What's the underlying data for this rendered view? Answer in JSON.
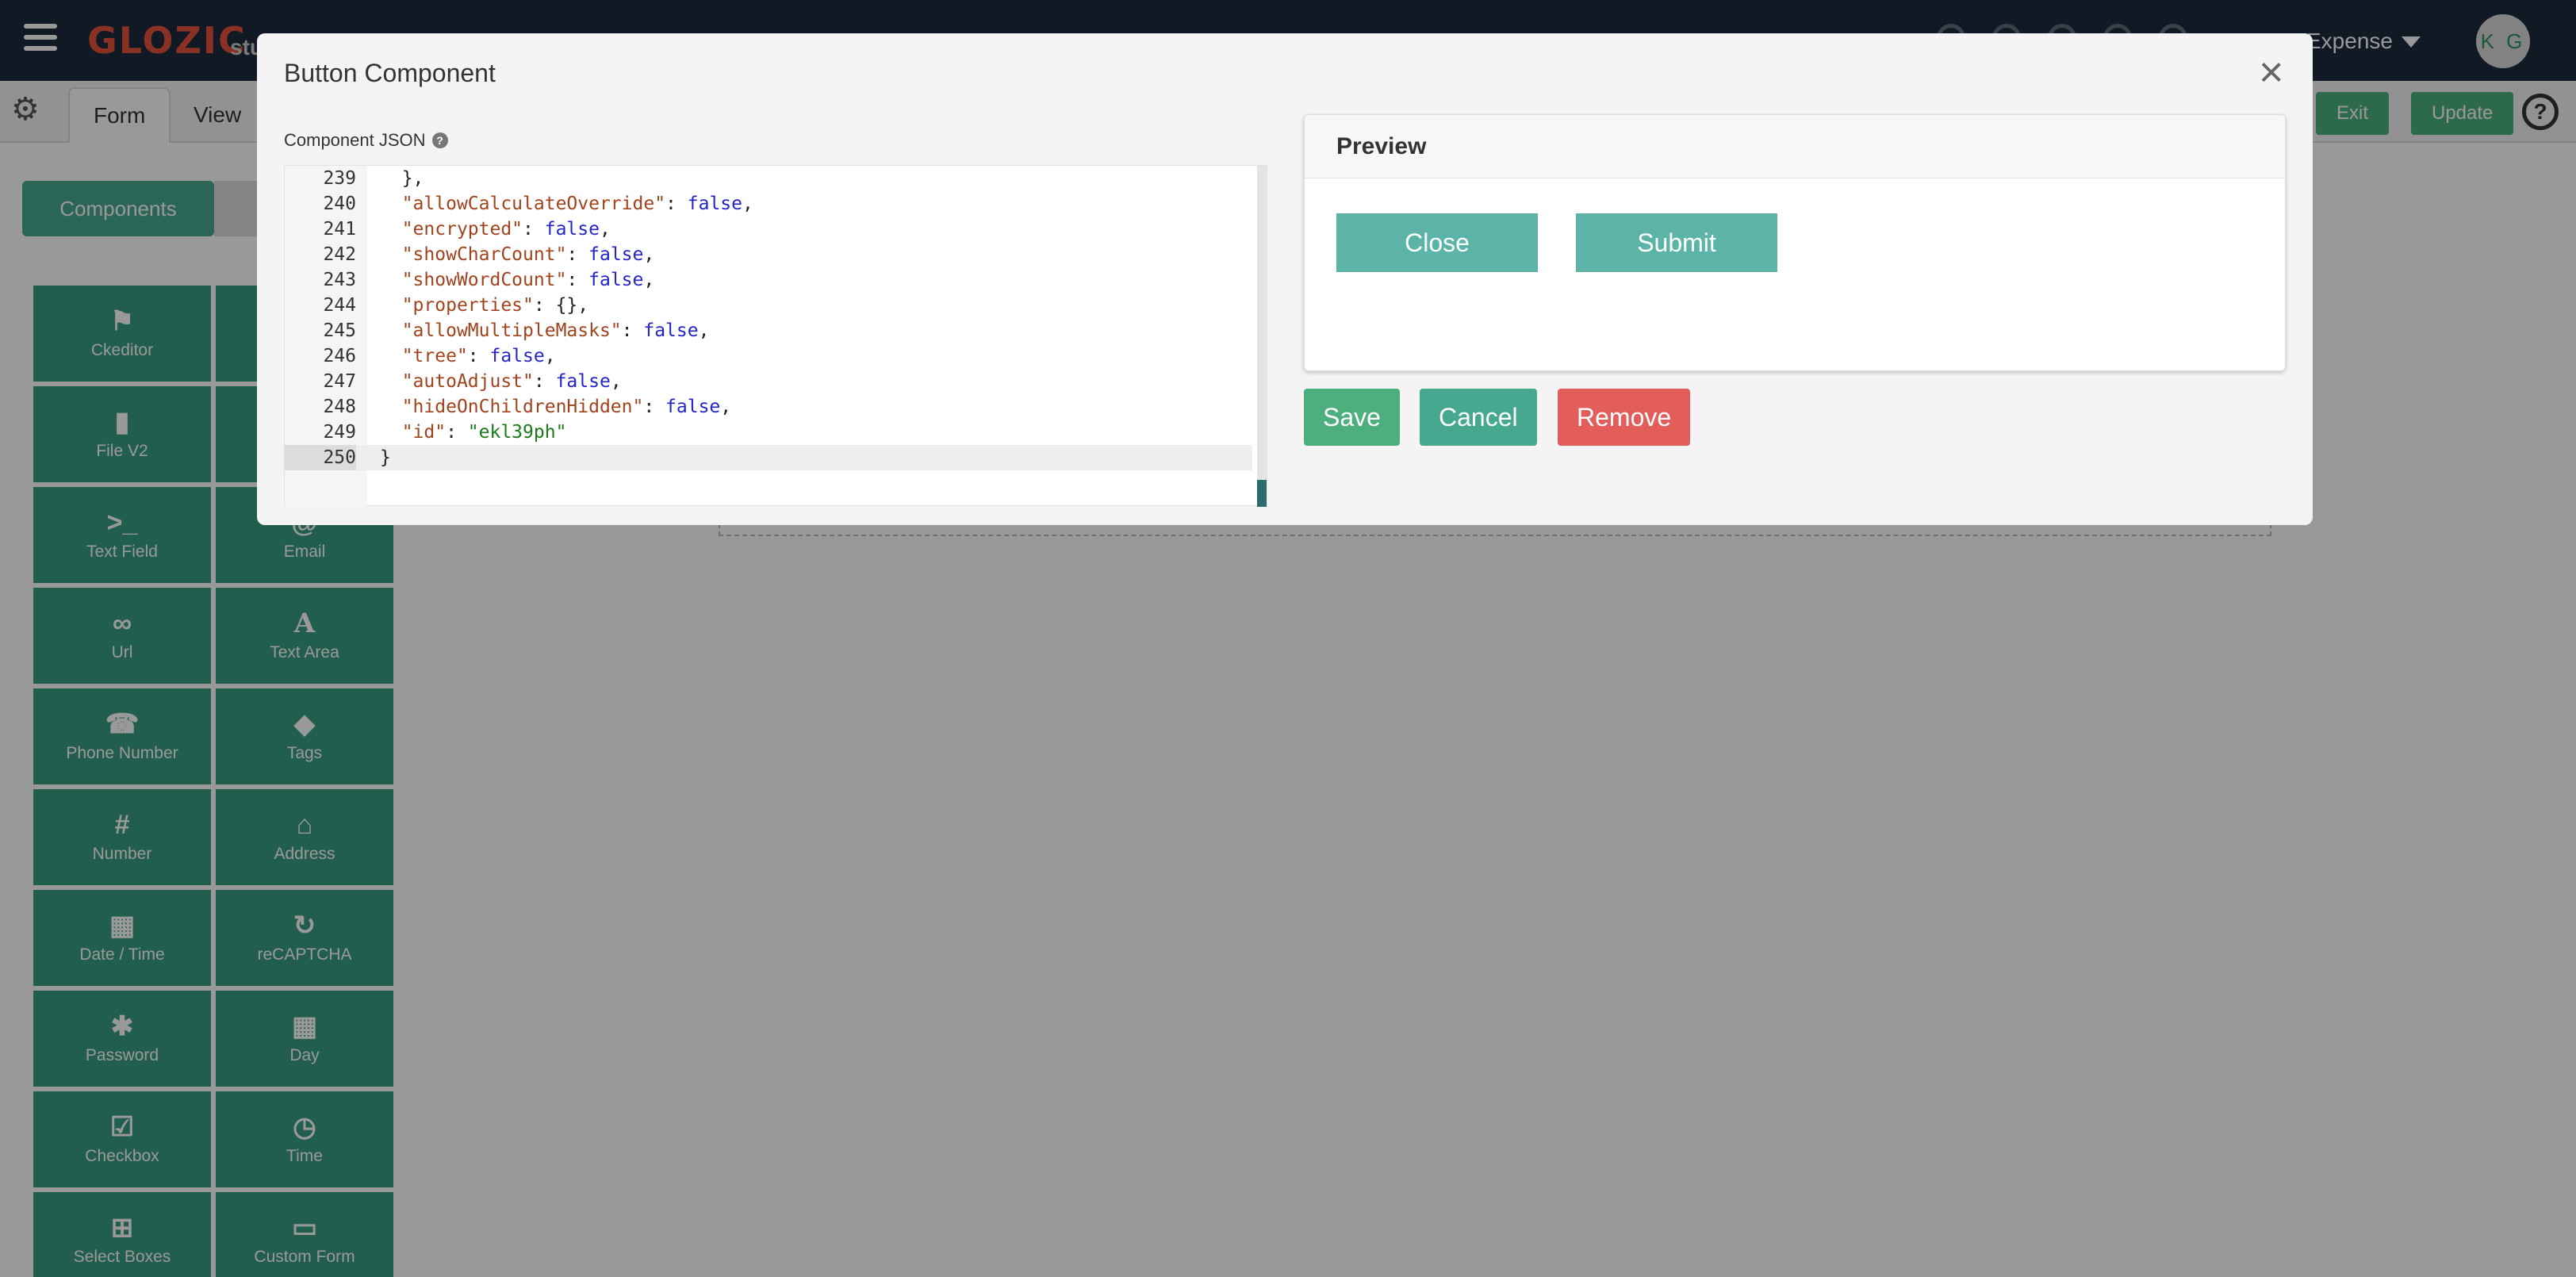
{
  "navbar": {
    "logo": "GLOZIC",
    "logo_sub": "stu",
    "app_name": "Expense",
    "avatar_initials": "K G"
  },
  "subbar": {
    "tabs": [
      "Form",
      "View"
    ],
    "active_tab": "Form",
    "exit_label": "Exit",
    "update_label": "Update",
    "help": "?"
  },
  "sidebar": {
    "components_tab": "Components",
    "palette": [
      {
        "label": "Ckeditor",
        "icon": "signpost-icon"
      },
      {
        "label": "",
        "icon": ""
      },
      {
        "label": "File V2",
        "icon": "file-icon"
      },
      {
        "label": "",
        "icon": ""
      },
      {
        "label": "Text Field",
        "icon": "terminal-icon"
      },
      {
        "label": "Email",
        "icon": "at-icon"
      },
      {
        "label": "Url",
        "icon": "link-icon"
      },
      {
        "label": "Text Area",
        "icon": "font-icon"
      },
      {
        "label": "Phone Number",
        "icon": "phone-icon"
      },
      {
        "label": "Tags",
        "icon": "tags-icon"
      },
      {
        "label": "Number",
        "icon": "hash-icon"
      },
      {
        "label": "Address",
        "icon": "home-icon"
      },
      {
        "label": "Date / Time",
        "icon": "calendar-icon"
      },
      {
        "label": "reCAPTCHA",
        "icon": "refresh-icon"
      },
      {
        "label": "Password",
        "icon": "asterisk-icon"
      },
      {
        "label": "Day",
        "icon": "calendar-icon"
      },
      {
        "label": "Checkbox",
        "icon": "check-square-icon"
      },
      {
        "label": "Time",
        "icon": "clock-icon"
      },
      {
        "label": "Select Boxes",
        "icon": "plus-square-icon"
      },
      {
        "label": "Custom Form",
        "icon": "credit-card-icon"
      }
    ]
  },
  "modal": {
    "title": "Button Component",
    "close": "×",
    "json_label": "Component JSON",
    "help_icon": "?",
    "code_lines": [
      {
        "n": "239",
        "text": "  },"
      },
      {
        "n": "240",
        "text": "  \"allowCalculateOverride\": false,"
      },
      {
        "n": "241",
        "text": "  \"encrypted\": false,"
      },
      {
        "n": "242",
        "text": "  \"showCharCount\": false,"
      },
      {
        "n": "243",
        "text": "  \"showWordCount\": false,"
      },
      {
        "n": "244",
        "text": "  \"properties\": {},"
      },
      {
        "n": "245",
        "text": "  \"allowMultipleMasks\": false,"
      },
      {
        "n": "246",
        "text": "  \"tree\": false,"
      },
      {
        "n": "247",
        "text": "  \"autoAdjust\": false,"
      },
      {
        "n": "248",
        "text": "  \"hideOnChildrenHidden\": false,"
      },
      {
        "n": "249",
        "text": "  \"id\": \"ekl39ph\""
      },
      {
        "n": "250",
        "text": "}"
      }
    ],
    "active_line": "250",
    "preview": {
      "title": "Preview",
      "close_button": "Close",
      "submit_button": "Submit"
    },
    "actions": {
      "save": "Save",
      "cancel": "Cancel",
      "remove": "Remove"
    }
  },
  "colors": {
    "navbar": "#1c2a3c",
    "teal": "#3a9d83",
    "preview_button": "#5cb4a8",
    "save": "#4caf7d",
    "cancel": "#46a98f",
    "remove": "#e35d5b"
  }
}
